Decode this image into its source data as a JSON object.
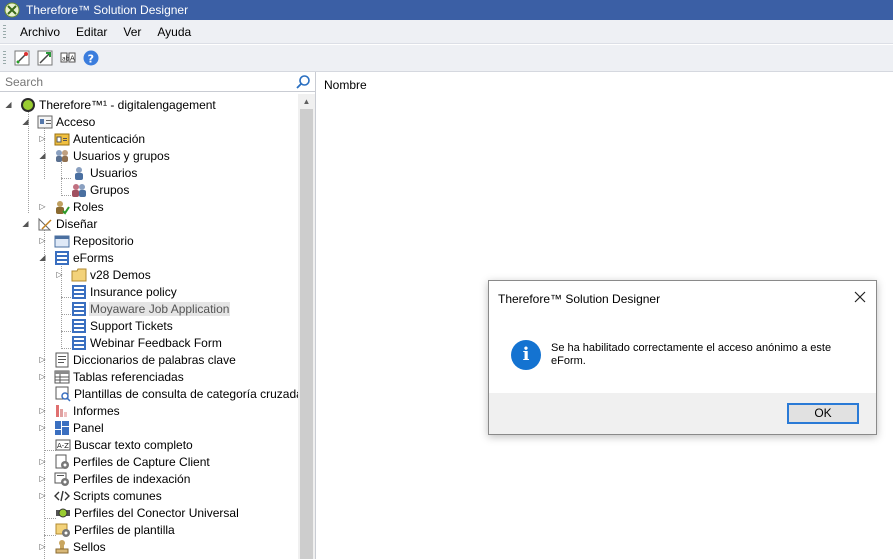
{
  "window": {
    "title": "Therefore™ Solution Designer"
  },
  "menu": [
    "Archivo",
    "Editar",
    "Ver",
    "Ayuda"
  ],
  "toolbar": {
    "icons": [
      "wizard-icon",
      "deploy-icon",
      "spellcheck-icon",
      "help-icon"
    ]
  },
  "search": {
    "placeholder": "Search"
  },
  "tree": {
    "root": "Therefore™¹ -  digitalengagement",
    "acceso": "Acceso",
    "autenticacion": "Autenticación",
    "usuarios_grupos": "Usuarios y grupos",
    "usuarios": "Usuarios",
    "grupos": "Grupos",
    "roles": "Roles",
    "disenar": "Diseñar",
    "repositorio": "Repositorio",
    "eforms": "eForms",
    "v28_demos": "v28 Demos",
    "insurance_policy": "Insurance policy",
    "moyaware": "Moyaware Job Application",
    "support_tickets": "Support Tickets",
    "webinar": "Webinar Feedback Form",
    "diccionarios": "Diccionarios de palabras clave",
    "tablas": "Tablas referenciadas",
    "plantillas_consulta": "Plantillas de consulta de categoría cruzada",
    "informes": "Informes",
    "panel": "Panel",
    "buscar": "Buscar texto completo",
    "perfiles_capture": "Perfiles de Capture Client",
    "perfiles_indexacion": "Perfiles de indexación",
    "scripts": "Scripts comunes",
    "perfiles_conector": "Perfiles del Conector Universal",
    "perfiles_plantilla": "Perfiles de plantilla",
    "sellos": "Sellos"
  },
  "list": {
    "column_header": "Nombre"
  },
  "dialog": {
    "title": "Therefore™ Solution Designer",
    "message": "Se ha habilitado correctamente el acceso anónimo a este eForm.",
    "ok_label": "OK"
  },
  "colors": {
    "titlebar": "#3b5fa5",
    "menubar": "#eef0f4",
    "ok_border": "#2a7ad6",
    "info_icon": "#1473d1"
  }
}
